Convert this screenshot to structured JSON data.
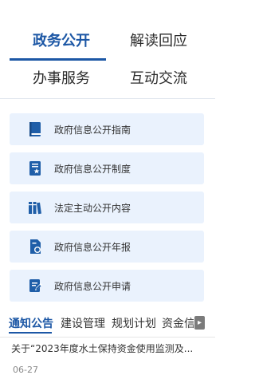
{
  "top_tabs": [
    "政务公开",
    "解读回应",
    "办事服务",
    "互动交流"
  ],
  "menu": [
    {
      "icon": "book-icon",
      "label": "政府信息公开指南"
    },
    {
      "icon": "document-star-icon",
      "label": "政府信息公开制度"
    },
    {
      "icon": "books-icon",
      "label": "法定主动公开内容"
    },
    {
      "icon": "report-icon",
      "label": "政府信息公开年报"
    },
    {
      "icon": "edit-form-icon",
      "label": "政府信息公开申请"
    }
  ],
  "sub_tabs": [
    "通知公告",
    "建设管理",
    "规划计划",
    "资金信"
  ],
  "news": {
    "title": "关于“2023年度水土保持资金使用监测及...",
    "date": "06-27"
  },
  "colors": {
    "accent": "#1c57a5",
    "card_bg": "#eaf2fd"
  }
}
